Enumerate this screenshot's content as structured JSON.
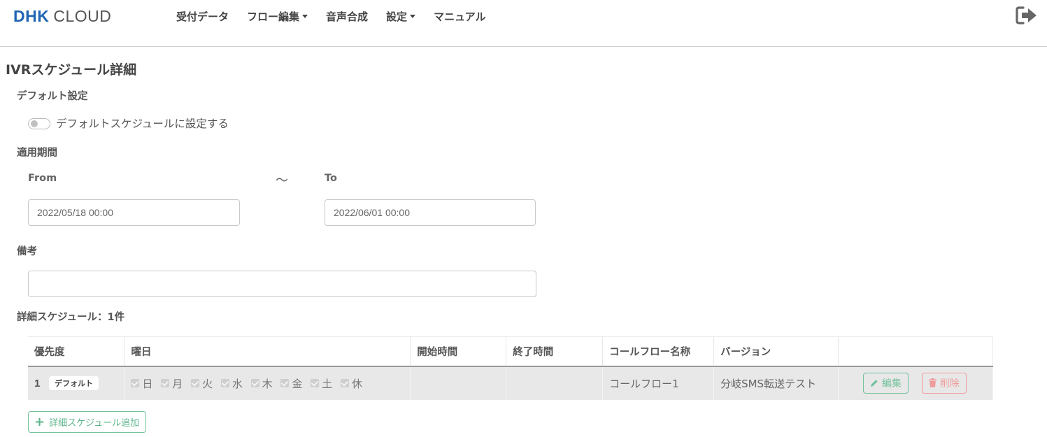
{
  "header": {
    "logo_dhk": "DHK",
    "logo_cloud": "CLOUD",
    "nav": [
      {
        "label": "受付データ",
        "dropdown": false
      },
      {
        "label": "フロー編集",
        "dropdown": true
      },
      {
        "label": "音声合成",
        "dropdown": false
      },
      {
        "label": "設定",
        "dropdown": true
      },
      {
        "label": "マニュアル",
        "dropdown": false
      }
    ],
    "logout_icon": "sign-out-icon"
  },
  "page": {
    "title": "IVRスケジュール詳細",
    "default_section": {
      "label": "デフォルト設定",
      "toggle_label": "デフォルトスケジュールに設定する",
      "toggle_on": false
    },
    "period_section": {
      "label": "適用期間",
      "from_label": "From",
      "separator": "〜",
      "to_label": "To",
      "from_value": "2022/05/18 00:00",
      "to_value": "2022/06/01 00:00"
    },
    "notes_section": {
      "label": "備考",
      "value": ""
    },
    "schedule_section": {
      "label": "詳細スケジュール：1件",
      "columns": [
        "優先度",
        "曜日",
        "開始時間",
        "終了時間",
        "コールフロー名称",
        "バージョン",
        ""
      ],
      "rows": [
        {
          "priority": "1",
          "badge": "デフォルト",
          "days": [
            "日",
            "月",
            "火",
            "水",
            "木",
            "金",
            "土",
            "休"
          ],
          "start": "",
          "end": "",
          "flow_name": "コールフロー1",
          "version": "分岐SMS転送テスト",
          "edit_label": "編集",
          "delete_label": "削除"
        }
      ],
      "add_label": "詳細スケジュール追加"
    }
  },
  "colors": {
    "brand": "#1f66b3",
    "edit": "#72c29b",
    "delete": "#ef9c9c",
    "row_bg": "#e8e8e8"
  }
}
